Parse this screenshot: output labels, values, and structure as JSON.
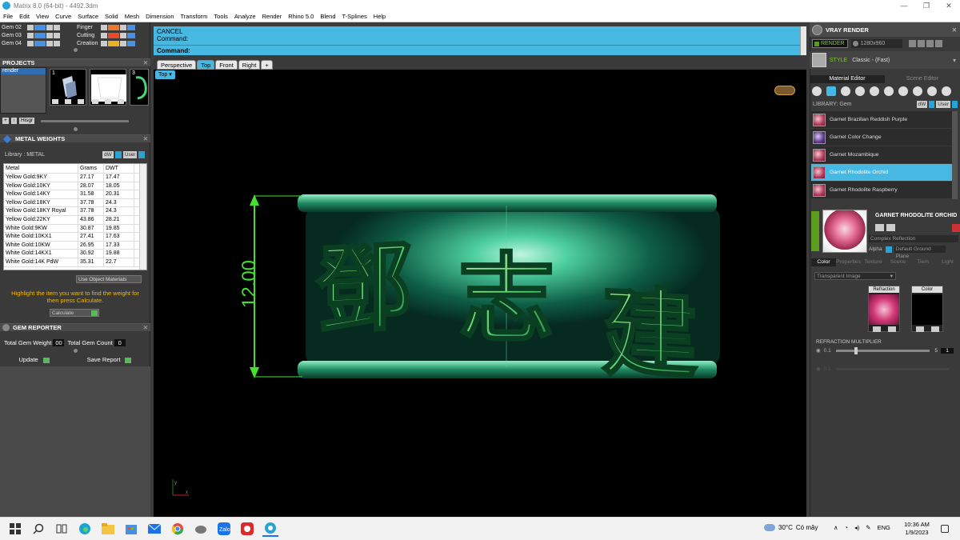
{
  "window": {
    "title": "Matrix 8.0 (64-bit) - 4492.3dm",
    "controls": [
      "—",
      "❐",
      "✕"
    ]
  },
  "menu": [
    "File",
    "Edit",
    "View",
    "Curve",
    "Surface",
    "Solid",
    "Mesh",
    "Dimension",
    "Transform",
    "Tools",
    "Analyze",
    "Render",
    "Rhino 5.0",
    "Blend",
    "T-Splines",
    "Help"
  ],
  "layers": {
    "left": [
      "Gem 02",
      "Gem 03",
      "Gem 04"
    ],
    "right": [
      "Finger",
      "Cutting",
      "Creation"
    ],
    "left_colors": [
      "#4a90e2",
      "#4a90e2",
      "#4a90e2"
    ],
    "right_colors": [
      "#e8782c",
      "#e84b2c",
      "#e8b02c"
    ]
  },
  "projects": {
    "title": "PROJECTS",
    "list_item": "render",
    "thumbs": [
      "1",
      "2",
      "3"
    ],
    "tools": [
      "+",
      "↑",
      "Hisgr"
    ]
  },
  "metal_weights": {
    "title": "METAL WEIGHTS",
    "library_label": "Library : METAL",
    "btn_dw": "dW",
    "btn_user": "User",
    "columns": [
      "Metal",
      "Grams",
      "DWT"
    ],
    "rows": [
      [
        "Yellow Gold:9KY",
        "27.17",
        "17.47"
      ],
      [
        "Yellow Gold:10KY",
        "28.07",
        "18.05"
      ],
      [
        "Yellow Gold:14KY",
        "31.58",
        "20.31"
      ],
      [
        "Yellow Gold:18KY",
        "37.78",
        "24.3"
      ],
      [
        "Yellow Gold:18KY Royal",
        "37.78",
        "24.3"
      ],
      [
        "Yellow Gold:22KY",
        "43.86",
        "28.21"
      ],
      [
        "White Gold:9KW",
        "30.87",
        "19.85"
      ],
      [
        "White Gold:10KX1",
        "27.41",
        "17.63"
      ],
      [
        "White Gold:10KW",
        "26.95",
        "17.33"
      ],
      [
        "White Gold:14KX1",
        "30.92",
        "19.88"
      ],
      [
        "White Gold:14K PdW",
        "35.31",
        "22.7"
      ]
    ],
    "use_object": "Use Object Materials",
    "hint": "Highlight the item you want to find the weight for then press Calculate.",
    "calculate": "Calculate"
  },
  "gem_reporter": {
    "title": "GEM REPORTER",
    "total_weight_label": "Total Gem Weight",
    "total_weight_value": "00",
    "total_count_label": "Total Gem Count",
    "total_count_value": "0",
    "update": "Update",
    "save_report": "Save Report"
  },
  "command": {
    "line1": "CANCEL",
    "line2": "Command:",
    "prompt": "Command:"
  },
  "view_tabs": [
    "Perspective",
    "Top",
    "Front",
    "Right",
    "+"
  ],
  "active_view_tab": "Top",
  "viewport": {
    "label": "Top",
    "dimension": "12.00",
    "characters": [
      "鄧",
      "志",
      "建"
    ],
    "axis": {
      "x": "x",
      "y": "y"
    }
  },
  "vray": {
    "title": "VRAY RENDER",
    "render_label": "RENDER",
    "resolution": "1280x960",
    "style_label": "STYLE",
    "style_value": "Classic - (Fast)"
  },
  "material_editor": {
    "tabs": [
      "Material Editor",
      "Scene Editor"
    ],
    "library_label": "LIBRARY: Gem",
    "btn_dw": "dW",
    "btn_user": "User",
    "gems": [
      "Garnet Brazilian Reddish Purple",
      "Garnet Color Change",
      "Garnet Mozambique",
      "Garnet Rhodolite Orchid",
      "Garnet Rhodolite Raspberry"
    ],
    "selected_gem": "Garnet Rhodolite Orchid",
    "selected_name": "GARNET RHODOLITE ORCHID",
    "reflection": "Complex Reflection",
    "alpha_label": "Alpha",
    "ground": "Default Ground Plane"
  },
  "property_tabs": [
    "Color",
    "Properties",
    "Texture",
    "Scene",
    "Tiem",
    "Light"
  ],
  "color_panel": {
    "image_type": "Transparent Image",
    "refraction_label": "Refraction",
    "color_label": "Color",
    "refraction_multiplier_label": "REFRACTION MULTIPLIER",
    "rm_min": "0.1",
    "rm_max": "5",
    "rm_value": "1",
    "rm_level": 0.2
  },
  "taskbar": {
    "weather": "30°C",
    "weather_desc": "Có mây",
    "lang": "ENG",
    "time": "10:36 AM",
    "date": "1/9/2023"
  }
}
